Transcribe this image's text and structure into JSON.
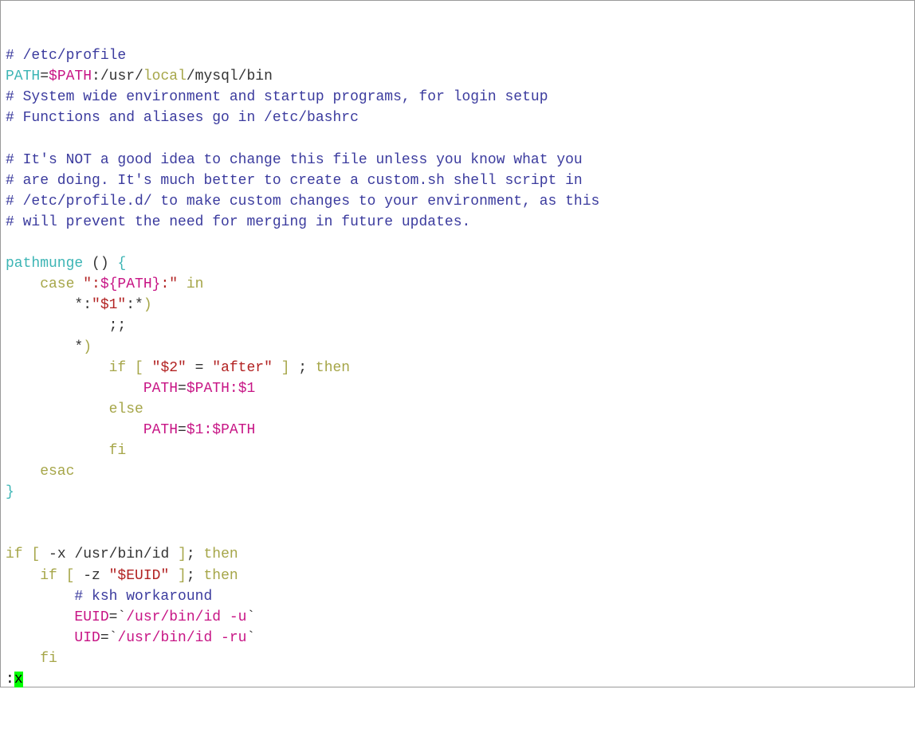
{
  "lines": {
    "l1": "# /etc/profile",
    "l2a": "PATH",
    "l2b": "=",
    "l2c": "$PATH",
    "l2d": ":/usr/",
    "l2e": "local",
    "l2f": "/mysql/bin",
    "l3": "# System wide environment and startup programs, for login setup",
    "l4": "# Functions and aliases go in /etc/bashrc",
    "l6": "# It's NOT a good idea to change this file unless you know what you",
    "l7": "# are doing. It's much better to create a custom.sh shell script in",
    "l8": "# /etc/profile.d/ to make custom changes to your environment, as this",
    "l9": "# will prevent the need for merging in future updates.",
    "l11a": "pathmunge ",
    "l11b": "()",
    "l11c": " {",
    "l12a": "    case",
    "l12b": " \":",
    "l12c": "${PATH}",
    "l12d": ":\"",
    "l12e": " in",
    "l13a": "        *:",
    "l13b": "\"$1\"",
    "l13c": ":*",
    "l13d": ")",
    "l14": "            ;;",
    "l15a": "        *",
    "l15b": ")",
    "l16a": "            if",
    "l16b": " [ ",
    "l16c": "\"$2\"",
    "l16d": " = ",
    "l16e": "\"after\"",
    "l16f": " ]",
    "l16g": " ; ",
    "l16h": "then",
    "l17a": "                PATH",
    "l17b": "=",
    "l17c": "$PATH",
    "l17d": ":",
    "l17e": "$1",
    "l18": "            else",
    "l19a": "                PATH",
    "l19b": "=",
    "l19c": "$1",
    "l19d": ":",
    "l19e": "$PATH",
    "l20": "            fi",
    "l21": "    esac",
    "l22": "}",
    "l25a": "if",
    "l25b": " [",
    "l25c": " -x ",
    "l25d": "/usr/bin/id",
    "l25e": " ]",
    "l25f": "; ",
    "l25g": "then",
    "l26a": "    if",
    "l26b": " [",
    "l26c": " -z",
    "l26d": " \"$EUID\"",
    "l26e": " ]",
    "l26f": "; ",
    "l26g": "then",
    "l27": "        # ksh workaround",
    "l28a": "        EUID",
    "l28b": "=`",
    "l28c": "/usr/bin/id -u",
    "l28d": "`",
    "l29a": "        UID",
    "l29b": "=`",
    "l29c": "/usr/bin/id -ru",
    "l29d": "`",
    "l30": "    fi",
    "cmd_colon": ":",
    "cmd_x": "x"
  }
}
